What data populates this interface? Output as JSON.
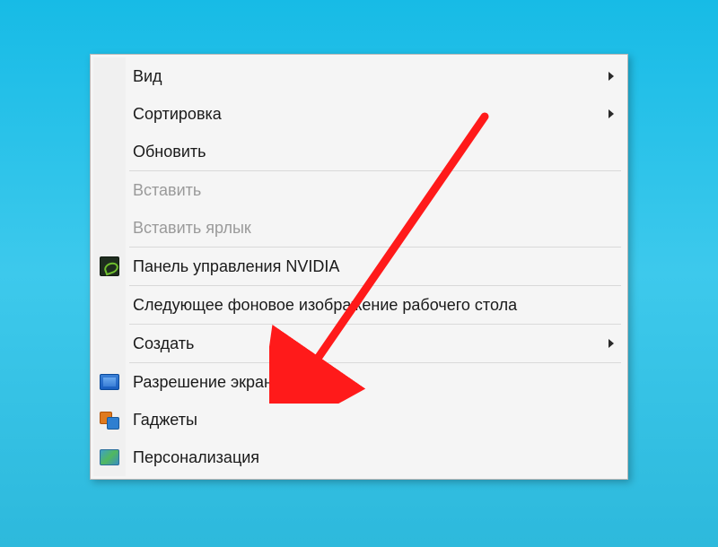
{
  "menu": {
    "items": [
      {
        "id": "view",
        "label": "Вид",
        "enabled": true,
        "submenu": true,
        "icon": null
      },
      {
        "id": "sort",
        "label": "Сортировка",
        "enabled": true,
        "submenu": true,
        "icon": null
      },
      {
        "id": "refresh",
        "label": "Обновить",
        "enabled": true,
        "submenu": false,
        "icon": null
      },
      {
        "sep": true
      },
      {
        "id": "paste",
        "label": "Вставить",
        "enabled": false,
        "submenu": false,
        "icon": null
      },
      {
        "id": "paste-short",
        "label": "Вставить ярлык",
        "enabled": false,
        "submenu": false,
        "icon": null
      },
      {
        "sep": true
      },
      {
        "id": "nvidia",
        "label": "Панель управления NVIDIA",
        "enabled": true,
        "submenu": false,
        "icon": "nvidia"
      },
      {
        "sep": true
      },
      {
        "id": "next-bg",
        "label": "Следующее фоновое изображение рабочего стола",
        "enabled": true,
        "submenu": false,
        "icon": null
      },
      {
        "sep": true
      },
      {
        "id": "new",
        "label": "Создать",
        "enabled": true,
        "submenu": true,
        "icon": null
      },
      {
        "sep": true
      },
      {
        "id": "resolution",
        "label": "Разрешение экрана",
        "enabled": true,
        "submenu": false,
        "icon": "resolution"
      },
      {
        "id": "gadgets",
        "label": "Гаджеты",
        "enabled": true,
        "submenu": false,
        "icon": "gadgets"
      },
      {
        "id": "personalize",
        "label": "Персонализация",
        "enabled": true,
        "submenu": false,
        "icon": "personalize"
      }
    ]
  },
  "annotation": {
    "arrow_color": "#ff1a1a",
    "target": "resolution"
  }
}
